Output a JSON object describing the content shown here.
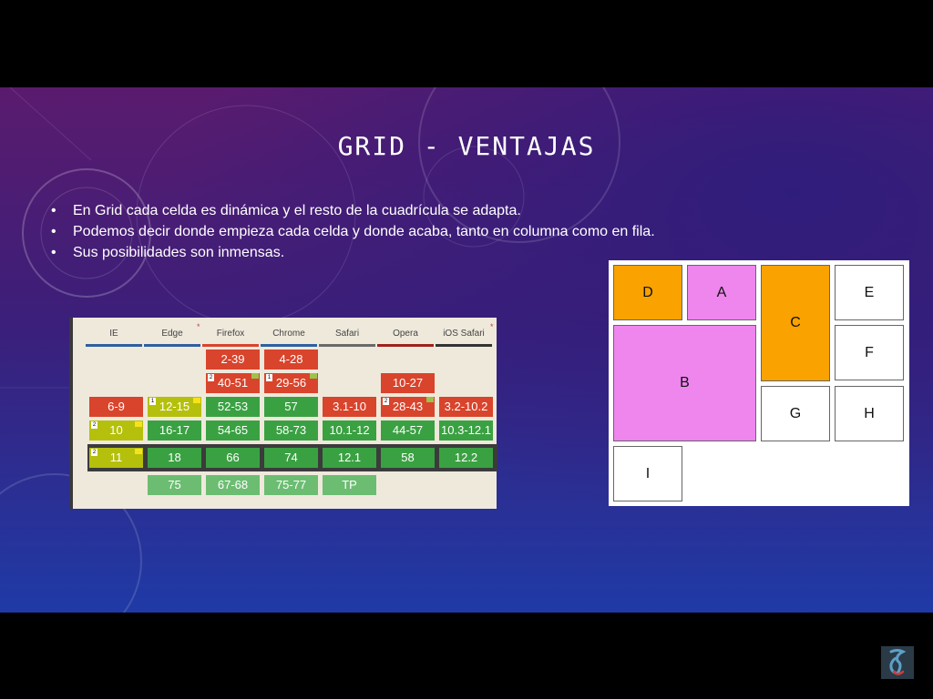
{
  "slide": {
    "title": "GRID - VENTAJAS",
    "bullets": [
      "En Grid cada celda es dinámica y el resto de la cuadrícula se adapta.",
      "Podemos decir donde empieza cada celda y donde acaba, tanto en columna como en fila.",
      "Sus posibilidades son inmensas."
    ]
  },
  "support_table": {
    "browsers": [
      "IE",
      "Edge",
      "Firefox",
      "Chrome",
      "Safari",
      "Opera",
      "iOS Safari"
    ],
    "rows": {
      "r1": [
        "",
        "",
        "2-39",
        "4-28",
        "",
        "",
        ""
      ],
      "r2": [
        "",
        "",
        "40-51",
        "29-56",
        "",
        "10-27",
        ""
      ],
      "r3": [
        "6-9",
        "12-15",
        "52-53",
        "57",
        "3.1-10",
        "28-43",
        "3.2-10.2"
      ],
      "r4": [
        "10",
        "16-17",
        "54-65",
        "58-73",
        "10.1-12",
        "44-57",
        "10.3-12.1"
      ],
      "current": [
        "11",
        "18",
        "66",
        "74",
        "12.1",
        "58",
        "12.2"
      ],
      "future": [
        "",
        "75",
        "67-68",
        "75-77",
        "TP",
        "",
        ""
      ]
    },
    "note_numbers": [
      "2",
      "1",
      "1",
      "2",
      "2"
    ]
  },
  "grid_demo": {
    "cells": [
      "D",
      "A",
      "C",
      "E",
      "B",
      "F",
      "G",
      "H",
      "I"
    ]
  },
  "colors": {
    "orange": "#f9a200",
    "pink": "#ee86ee"
  }
}
